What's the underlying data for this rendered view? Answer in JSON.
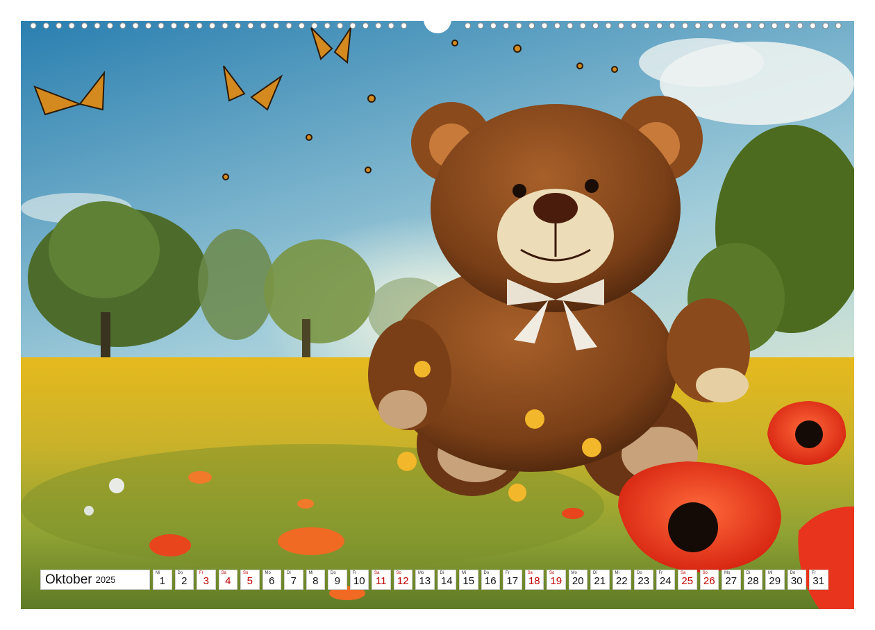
{
  "calendar": {
    "month": "Oktober",
    "year": "2025",
    "days": [
      {
        "wd": "Mi",
        "n": "1",
        "weekend": false
      },
      {
        "wd": "Do",
        "n": "2",
        "weekend": false
      },
      {
        "wd": "Fr",
        "n": "3",
        "weekend": true
      },
      {
        "wd": "Sa",
        "n": "4",
        "weekend": true
      },
      {
        "wd": "So",
        "n": "5",
        "weekend": true
      },
      {
        "wd": "Mo",
        "n": "6",
        "weekend": false
      },
      {
        "wd": "Di",
        "n": "7",
        "weekend": false
      },
      {
        "wd": "Mi",
        "n": "8",
        "weekend": false
      },
      {
        "wd": "Do",
        "n": "9",
        "weekend": false
      },
      {
        "wd": "Fr",
        "n": "10",
        "weekend": false
      },
      {
        "wd": "Sa",
        "n": "11",
        "weekend": true
      },
      {
        "wd": "So",
        "n": "12",
        "weekend": true
      },
      {
        "wd": "Mo",
        "n": "13",
        "weekend": false
      },
      {
        "wd": "Di",
        "n": "14",
        "weekend": false
      },
      {
        "wd": "Mi",
        "n": "15",
        "weekend": false
      },
      {
        "wd": "Do",
        "n": "16",
        "weekend": false
      },
      {
        "wd": "Fr",
        "n": "17",
        "weekend": false
      },
      {
        "wd": "Sa",
        "n": "18",
        "weekend": true
      },
      {
        "wd": "So",
        "n": "19",
        "weekend": true
      },
      {
        "wd": "Mo",
        "n": "20",
        "weekend": false
      },
      {
        "wd": "Di",
        "n": "21",
        "weekend": false
      },
      {
        "wd": "Mi",
        "n": "22",
        "weekend": false
      },
      {
        "wd": "Do",
        "n": "23",
        "weekend": false
      },
      {
        "wd": "Fr",
        "n": "24",
        "weekend": false
      },
      {
        "wd": "Sa",
        "n": "25",
        "weekend": true
      },
      {
        "wd": "So",
        "n": "26",
        "weekend": true
      },
      {
        "wd": "Mo",
        "n": "27",
        "weekend": false
      },
      {
        "wd": "Di",
        "n": "28",
        "weekend": false
      },
      {
        "wd": "Mi",
        "n": "29",
        "weekend": false
      },
      {
        "wd": "Do",
        "n": "30",
        "weekend": false
      },
      {
        "wd": "Fr",
        "n": "31",
        "weekend": false
      }
    ]
  },
  "colors": {
    "holiday_red": "#c00000",
    "sky_top": "#2f87b3",
    "meadow": "#d9b526",
    "bear": "#8a4a1c",
    "poppy": "#e8341c"
  },
  "image": {
    "icons": [
      "teddy-bear-illustration",
      "butterfly-icon",
      "poppy-flower-icon",
      "tree-icon",
      "binding-hole-icon"
    ]
  }
}
